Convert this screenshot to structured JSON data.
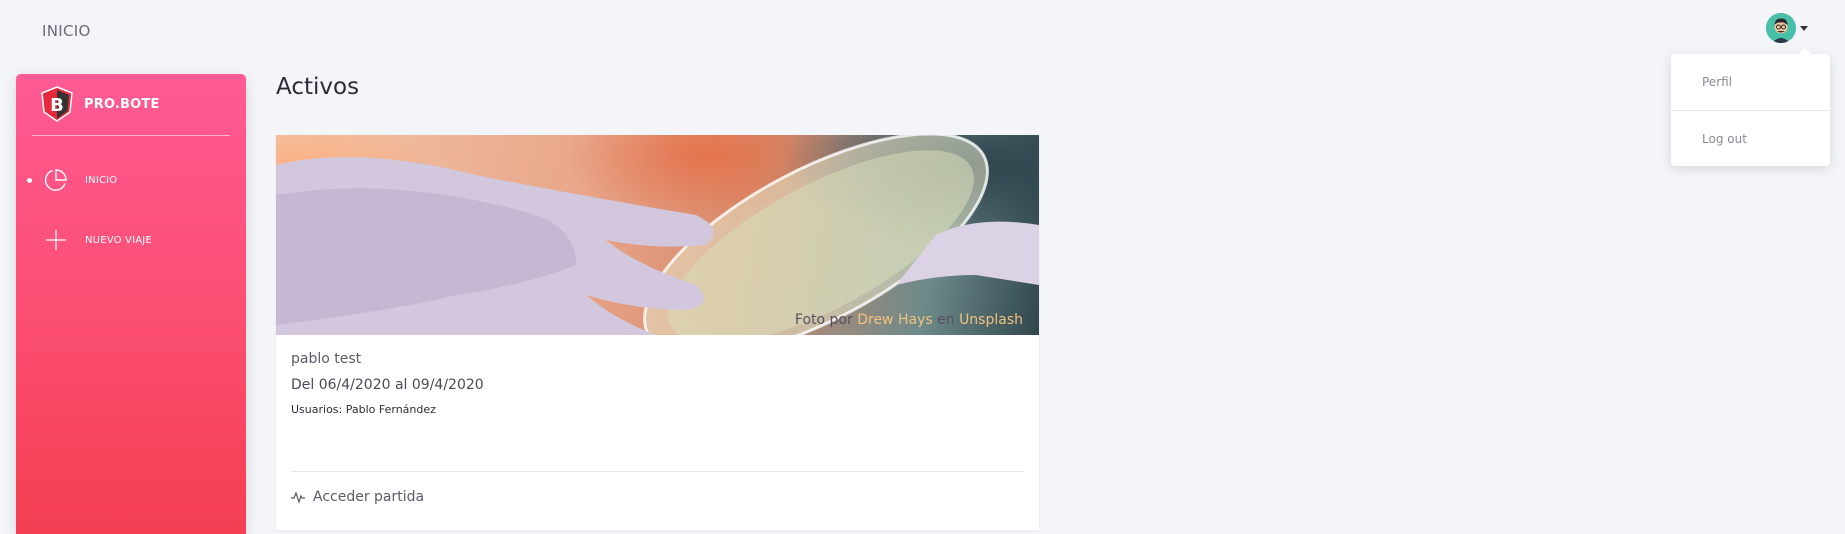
{
  "header": {
    "title": "INICIO",
    "user_menu": {
      "items": [
        {
          "label": "Perfil"
        },
        {
          "label": "Log out"
        }
      ]
    }
  },
  "sidebar": {
    "brand": "PRO.BOTE",
    "items": [
      {
        "label": "INICIO",
        "icon": "pie-chart-icon",
        "active": true
      },
      {
        "label": "NUEVO VIAJE",
        "icon": "plus-icon",
        "active": false
      }
    ]
  },
  "main": {
    "title": "Activos",
    "card": {
      "photo_credit": {
        "prefix": "Foto por",
        "author": "Drew Hays",
        "middle": "en",
        "source": "Unsplash"
      },
      "trip_name": "pablo test",
      "dates": "Del 06/4/2020 al 09/4/2020",
      "users": "Usuarios: Pablo Fernández",
      "action_label": "Acceder partida",
      "action_icon": "activity-icon"
    }
  },
  "colors": {
    "sidebar_top": "#ff5a95",
    "sidebar_bottom": "#f43f52",
    "background": "#f4f5f9",
    "credit_link": "#f2c17c"
  }
}
